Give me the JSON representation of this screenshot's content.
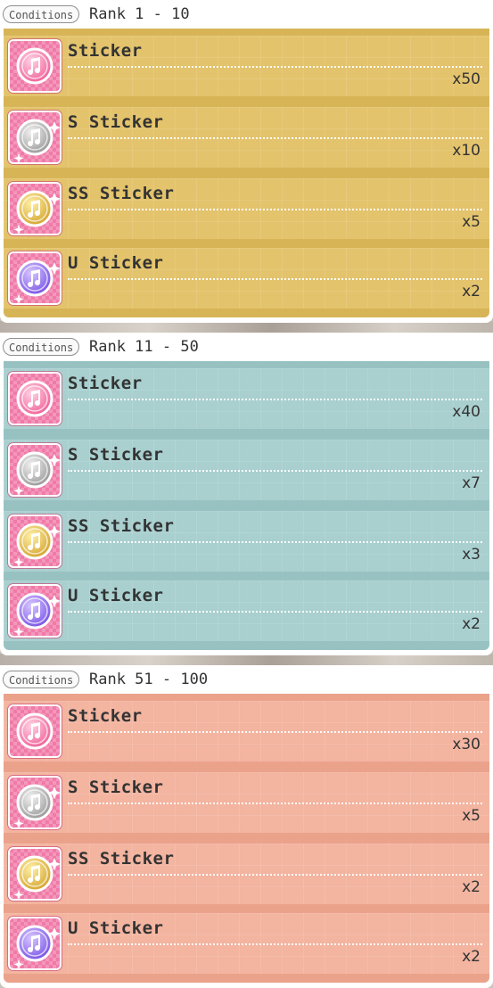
{
  "label_conditions": "Conditions",
  "item_icon_name": "music-note-icon",
  "tiers": [
    {
      "rank_label": "Rank 1 - 10",
      "colors": {
        "row": "#e3c36c",
        "sep": "#d7b557"
      },
      "items": [
        {
          "name": "Sticker",
          "qty": "x50",
          "medal": "pink"
        },
        {
          "name": "S Sticker",
          "qty": "x10",
          "medal": "silver"
        },
        {
          "name": "SS Sticker",
          "qty": "x5",
          "medal": "gold"
        },
        {
          "name": "U Sticker",
          "qty": "x2",
          "medal": "purple"
        }
      ]
    },
    {
      "rank_label": "Rank 11 - 50",
      "colors": {
        "row": "#a9cfcf",
        "sep": "#98c2c2"
      },
      "items": [
        {
          "name": "Sticker",
          "qty": "x40",
          "medal": "pink"
        },
        {
          "name": "S Sticker",
          "qty": "x7",
          "medal": "silver"
        },
        {
          "name": "SS Sticker",
          "qty": "x3",
          "medal": "gold"
        },
        {
          "name": "U Sticker",
          "qty": "x2",
          "medal": "purple"
        }
      ]
    },
    {
      "rank_label": "Rank 51 - 100",
      "colors": {
        "row": "#f3b4a0",
        "sep": "#eba28b"
      },
      "items": [
        {
          "name": "Sticker",
          "qty": "x30",
          "medal": "pink"
        },
        {
          "name": "S Sticker",
          "qty": "x5",
          "medal": "silver"
        },
        {
          "name": "SS Sticker",
          "qty": "x2",
          "medal": "gold"
        },
        {
          "name": "U Sticker",
          "qty": "x2",
          "medal": "purple"
        }
      ]
    }
  ],
  "medal_colors": {
    "pink": [
      "#ffd3e4",
      "#f0639a"
    ],
    "silver": [
      "#f2f2f2",
      "#9a9a9a"
    ],
    "gold": [
      "#fff0a8",
      "#d5a630"
    ],
    "purple": [
      "#d9c8ff",
      "#7a55e6"
    ]
  }
}
